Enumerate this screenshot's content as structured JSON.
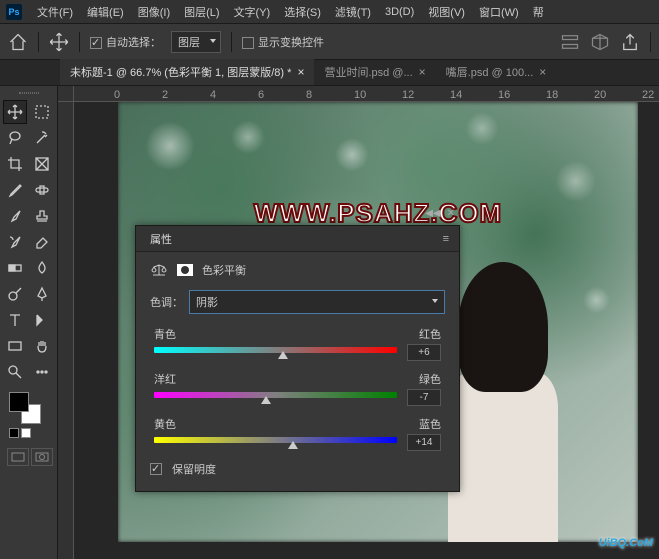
{
  "menu": [
    "文件(F)",
    "编辑(E)",
    "图像(I)",
    "图层(L)",
    "文字(Y)",
    "选择(S)",
    "滤镜(T)",
    "3D(D)",
    "视图(V)",
    "窗口(W)",
    "帮"
  ],
  "options": {
    "auto_select": "自动选择：",
    "auto_select_checked": true,
    "target": "图层",
    "show_transform": "显示变换控件",
    "show_transform_checked": false
  },
  "tabs": [
    {
      "label": "未标题-1 @ 66.7% (色彩平衡 1, 图层蒙版/8) *",
      "active": true
    },
    {
      "label": "营业时间.psd @...",
      "active": false
    },
    {
      "label": "嘴唇.psd @ 100...",
      "active": false
    }
  ],
  "ruler_marks": [
    "0",
    "2",
    "4",
    "6",
    "8",
    "10",
    "12",
    "14",
    "16",
    "18",
    "20",
    "22"
  ],
  "watermark": "WWW.PSAHZ.COM",
  "uibq": "UiBQ.CoM",
  "panel": {
    "title": "属性",
    "adjustment": "色彩平衡",
    "tone_label": "色调：",
    "tone_value": "阴影",
    "sliders": [
      {
        "left": "青色",
        "right": "红色",
        "value": "+6",
        "pos": 53,
        "grad": "gr-cyan-red"
      },
      {
        "left": "洋红",
        "right": "绿色",
        "value": "-7",
        "pos": 46,
        "grad": "gr-mag-green"
      },
      {
        "left": "黄色",
        "right": "蓝色",
        "value": "+14",
        "pos": 57,
        "grad": "gr-yel-blue"
      }
    ],
    "preserve_lum": "保留明度",
    "preserve_lum_checked": true
  }
}
